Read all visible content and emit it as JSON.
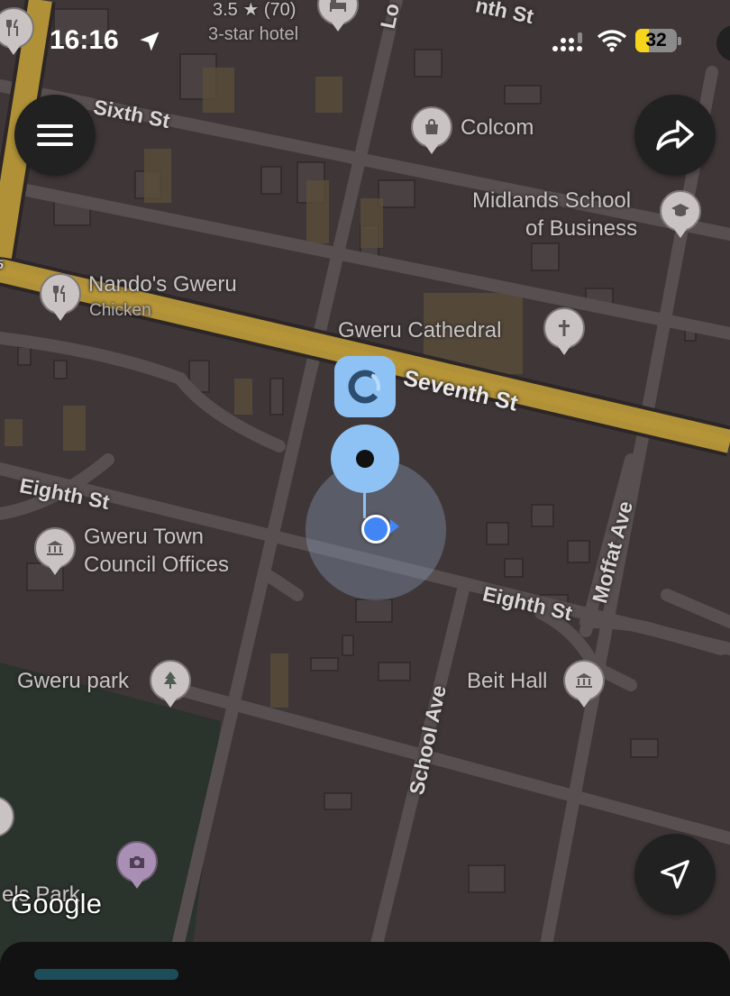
{
  "status_bar": {
    "time": "16:16",
    "battery": "32",
    "battery_level": 0.32
  },
  "map": {
    "hotel": {
      "rating_line": "3.5 ★ (70)",
      "category": "3-star hotel"
    },
    "places": {
      "colcom": "Colcom",
      "midlands_line1": "Midlands School",
      "midlands_line2": "of Business",
      "nandos": "Nando's Gweru",
      "nandos_sub": "Chicken",
      "cathedral": "Gweru Cathedral",
      "town_council_line1": "Gweru Town",
      "town_council_line2": "Council Offices",
      "gweru_park": "Gweru park",
      "beit_hall": "Beit Hall",
      "park_partial": "els Park"
    },
    "streets": {
      "sixth": "Sixth St",
      "seventh": "Seventh St",
      "eighth_west": "Eighth St",
      "eighth_east": "Eighth St",
      "moffat": "Moffat Ave",
      "school": "School Ave",
      "top_partial": "nth St",
      "top_vertical_partial": "Lo",
      "edge_marker": "5"
    }
  },
  "attribution": "Google",
  "icons": {
    "menu": "menu-icon",
    "directions": "directions-icon",
    "my_location": "navigation-arrow-icon",
    "restaurant": "fork-knife-icon",
    "shopping": "shopping-bag-icon",
    "school": "graduation-cap-icon",
    "church": "cross-icon",
    "government": "government-building-icon",
    "park": "tree-icon",
    "photo": "camera-icon",
    "hotel": "bed-icon",
    "loading": "loading-spinner-icon",
    "pickup": "pickup-pin-icon"
  },
  "colors": {
    "accent_blue": "#8ec2f5",
    "location_dot": "#4285f4",
    "major_road": "#b09137",
    "park": "#2a332c"
  }
}
